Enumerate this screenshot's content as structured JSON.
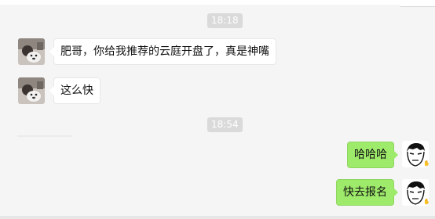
{
  "chat": {
    "timestamps": [
      "18:18",
      "18:54"
    ],
    "messages": [
      {
        "side": "left",
        "text": "肥哥，你给我推荐的云庭开盘了，真是神嘴"
      },
      {
        "side": "left",
        "text": "这么快"
      },
      {
        "side": "right",
        "text": "哈哈哈"
      },
      {
        "side": "right",
        "text": "快去报名"
      }
    ]
  },
  "colors": {
    "background": "#f5f5f5",
    "left_bubble": "#ffffff",
    "right_bubble": "#9eea6a",
    "timestamp_bg": "#dadada"
  },
  "icons": {
    "contact_avatar": "contact-photo-avatar",
    "self_avatar": "cartoon-face-avatar"
  }
}
